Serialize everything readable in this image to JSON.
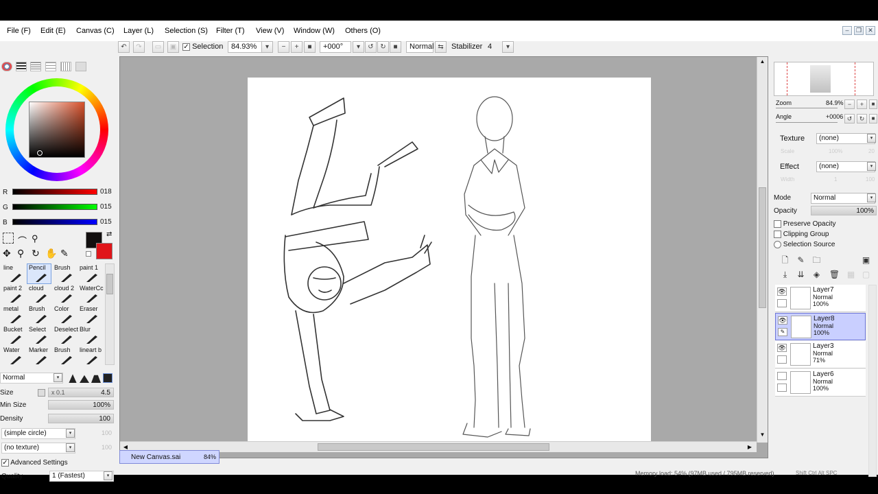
{
  "menu": [
    "File (F)",
    "Edit (E)",
    "Canvas (C)",
    "Layer (L)",
    "Selection (S)",
    "Filter (T)",
    "View (V)",
    "Window (W)",
    "Others (O)"
  ],
  "toolbar": {
    "selection_label": "Selection",
    "zoom": "84.93%",
    "angle": "+000°",
    "blend": "Normal",
    "stabilizer_label": "Stabilizer",
    "stabilizer_value": "4"
  },
  "color": {
    "r_label": "R",
    "r_value": "018",
    "g_label": "G",
    "g_value": "015",
    "b_label": "B",
    "b_value": "015",
    "main_hex": "#120f0f"
  },
  "tools": [
    {
      "label": "line"
    },
    {
      "label": "Pencil",
      "selected": true
    },
    {
      "label": "Brush"
    },
    {
      "label": "paint 1"
    },
    {
      "label": "paint 2"
    },
    {
      "label": "cloud"
    },
    {
      "label": "cloud 2"
    },
    {
      "label": "WaterCc"
    },
    {
      "label": "metal"
    },
    {
      "label": "Brush"
    },
    {
      "label": "Color"
    },
    {
      "label": "Eraser"
    },
    {
      "label": "Bucket"
    },
    {
      "label": "Select"
    },
    {
      "label": "Deselect"
    },
    {
      "label": "Blur"
    },
    {
      "label": "Water"
    },
    {
      "label": "Marker"
    },
    {
      "label": "Brush"
    },
    {
      "label": "lineart b"
    }
  ],
  "brush": {
    "blend": "Normal",
    "size_label": "Size",
    "size_mult": "x 0.1",
    "size_value": "4.5",
    "minsize_label": "Min Size",
    "minsize_value": "100%",
    "density_label": "Density",
    "density_value": "100",
    "shape": "(simple circle)",
    "shape_val": "100",
    "texture": "(no texture)",
    "texture_val": "100",
    "advanced_label": "Advanced Settings",
    "quality_label": "Quality",
    "quality_value": "1 (Fastest)"
  },
  "navigator": {
    "zoom_label": "Zoom",
    "zoom_value": "84.9%",
    "angle_label": "Angle",
    "angle_value": "+0006"
  },
  "layer_props": {
    "texture_label": "Texture",
    "texture_value": "(none)",
    "texture_scale_label": "Scale",
    "texture_scale_value": "100%",
    "texture_scale_num": "20",
    "effect_label": "Effect",
    "effect_value": "(none)",
    "effect_width_label": "Width",
    "effect_width_value": "1",
    "effect_width_num": "100",
    "mode_label": "Mode",
    "mode_value": "Normal",
    "opacity_label": "Opacity",
    "opacity_value": "100%",
    "preserve_label": "Preserve Opacity",
    "clipping_label": "Clipping Group",
    "source_label": "Selection Source"
  },
  "layers": [
    {
      "name": "Layer7",
      "mode": "Normal",
      "opacity": "100%",
      "visible": true,
      "selected": false
    },
    {
      "name": "Layer8",
      "mode": "Normal",
      "opacity": "100%",
      "visible": true,
      "selected": true
    },
    {
      "name": "Layer3",
      "mode": "Normal",
      "opacity": "71%",
      "visible": true,
      "selected": false
    },
    {
      "name": "Layer6",
      "mode": "Normal",
      "opacity": "100%",
      "visible": false,
      "selected": false
    }
  ],
  "document": {
    "name": "New Canvas.sai",
    "zoom": "84%"
  },
  "status": {
    "memory": "Memory load: 54% (97MB used / 795MB reserved)",
    "keys": "Shift Ctrl Alt SPC"
  }
}
